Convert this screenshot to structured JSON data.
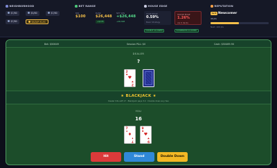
{
  "header": {
    "neighborhood": {
      "title": "NEIGHBORHOOD",
      "buttons": [
        {
          "label": "$7/80"
        },
        {
          "label": "$5/80"
        },
        {
          "label": "$7/80"
        },
        {
          "label": "$7/80"
        },
        {
          "label": "BAZAR KLAS"
        }
      ]
    },
    "bet_range": {
      "title": "BET RANGE",
      "min_label": "MIN",
      "min_value": "$100",
      "bank_label": "BANK",
      "bank_value": "$26,448",
      "bank_change": "+$178",
      "net_label": "NET WIN",
      "net_value": "+$26,448",
      "net_sub": "+26,348"
    },
    "house_edge": {
      "title": "HOUSE EDGE",
      "you_label": "YOUR EDGE",
      "you_value": "0.59%",
      "you_sub": "Basic Strategy",
      "house_label": "HOUSE EDGE",
      "house_value": "1.26%",
      "house_sub": "via 0 decks",
      "btn_left": "DOUBLE ALLOWED",
      "btn_right": "SURRENDER ALLOWED"
    },
    "reputation": {
      "title": "REPUTATION",
      "level_badge": "Lv.1",
      "rank": "Newcomer",
      "xp": "49 pts",
      "progress_label": "Next: 100 pts",
      "progress": 0.49
    }
  },
  "table": {
    "bet": "Bet: $50649",
    "session": "Session P&L: $0",
    "cash": "Cash: $50469.90",
    "dealer_label": "DEALER",
    "dealer_total": "?",
    "dealer_cards": [
      {
        "rank": "2",
        "suit": "♥"
      }
    ],
    "result_title": "★ BLACKJACK ★",
    "result_sub": "Dealer hits soft 17 · Blackjack pays 3:2 · Double down any two",
    "you_label": "YOU",
    "you_total": "16",
    "you_cards": [
      {
        "rank": "7",
        "suit": "♦"
      },
      {
        "rank": "9",
        "suit": "♥"
      }
    ]
  },
  "actions": {
    "hit": "Hit",
    "stand": "Stand",
    "double": "Double Down"
  },
  "colors": {
    "hit": "#dc3a3a",
    "stand": "#2f88d8",
    "double": "#f2b824",
    "felt": "#1c4d2a",
    "accent_gold": "#f5c04a"
  }
}
